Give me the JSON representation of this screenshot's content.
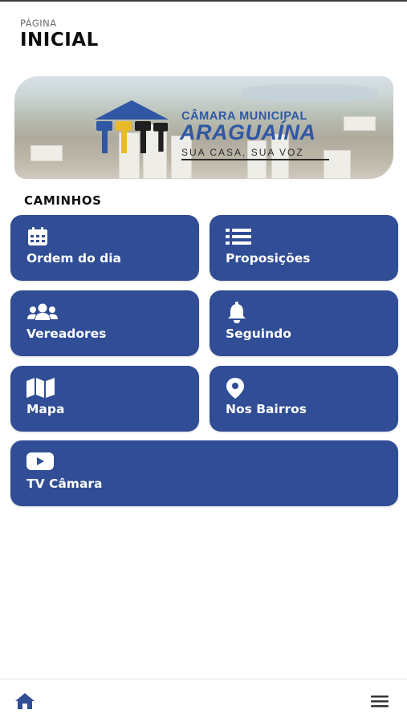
{
  "header": {
    "kicker": "PÁGINA",
    "title": "INICIAL"
  },
  "banner": {
    "logo_line1": "CÂMARA MUNICIPAL",
    "logo_line2": "ARAGUAÍNA",
    "slogan": "SUA CASA, SUA VOZ",
    "colors": {
      "brand_blue": "#2f57a4",
      "figure_yellow": "#e8b928",
      "figure_dark": "#1f1f1f"
    }
  },
  "section": {
    "title": "CAMINHOS"
  },
  "tiles": [
    {
      "label": "Ordem do dia",
      "icon": "calendar-icon"
    },
    {
      "label": "Proposições",
      "icon": "list-icon"
    },
    {
      "label": "Vereadores",
      "icon": "users-icon"
    },
    {
      "label": "Seguindo",
      "icon": "bell-icon"
    },
    {
      "label": "Mapa",
      "icon": "map-icon"
    },
    {
      "label": "Nos Bairros",
      "icon": "map-pin-icon"
    },
    {
      "label": "TV Câmara",
      "icon": "youtube-icon"
    }
  ],
  "bottom_nav": {
    "home_icon": "home-icon",
    "menu_icon": "hamburger-menu-icon"
  },
  "colors": {
    "tile_bg": "#304d95",
    "nav_accent": "#304d95",
    "text_dark": "#0d0d0d"
  }
}
